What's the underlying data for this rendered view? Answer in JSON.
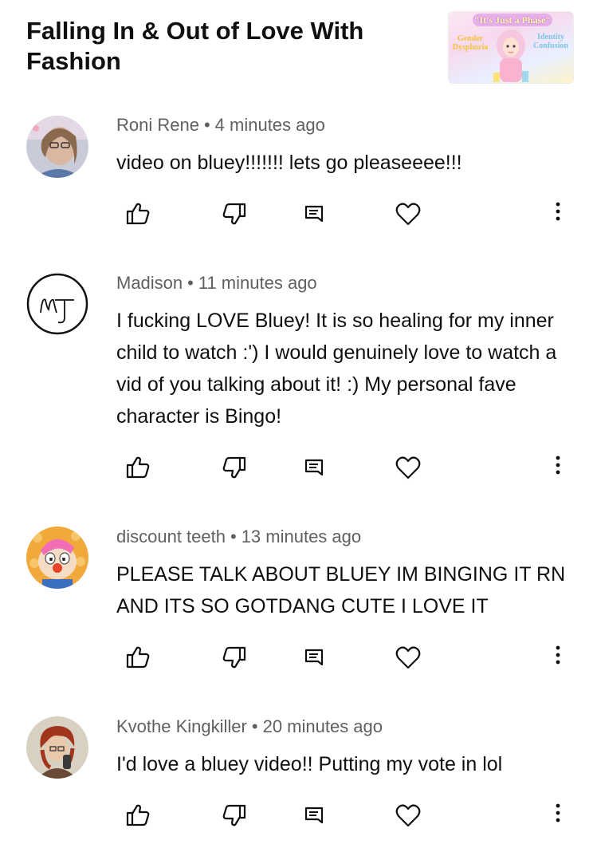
{
  "video": {
    "title": "Falling In & Out of Love With Fashion",
    "thumbnail": {
      "banner_text": "\"It's Just a Phase\"",
      "left_text": "Gender Dysphoria",
      "right_text": "Identity Confusion"
    }
  },
  "comments": [
    {
      "author": "Roni Rene",
      "separator": "•",
      "time": "4 minutes ago",
      "text": "video on bluey!!!!!!! lets go pleaseeee!!!",
      "avatar": "photo-avatar"
    },
    {
      "author": "Madison",
      "separator": "•",
      "time": "11 minutes ago",
      "text": "I fucking LOVE Bluey! It is so healing for my inner child to watch :') I would genuinely love to watch a vid of you talking about it! :) My personal fave character is Bingo!",
      "avatar": "monogram-avatar"
    },
    {
      "author": "discount teeth",
      "separator": "•",
      "time": "13 minutes ago",
      "text": "PLEASE TALK ABOUT BLUEY IM BINGING IT RN AND ITS SO GOTDANG CUTE I LOVE IT",
      "avatar": "cartoon-avatar"
    },
    {
      "author": "Kvothe Kingkiller",
      "separator": "•",
      "time": "20 minutes ago",
      "text": "I'd love a bluey video!! Putting my vote in lol",
      "avatar": "illustration-avatar"
    }
  ],
  "icons": {
    "like": "thumbs-up-icon",
    "dislike": "thumbs-down-icon",
    "reply": "reply-icon",
    "heart": "heart-icon",
    "more": "more-vertical-icon"
  }
}
